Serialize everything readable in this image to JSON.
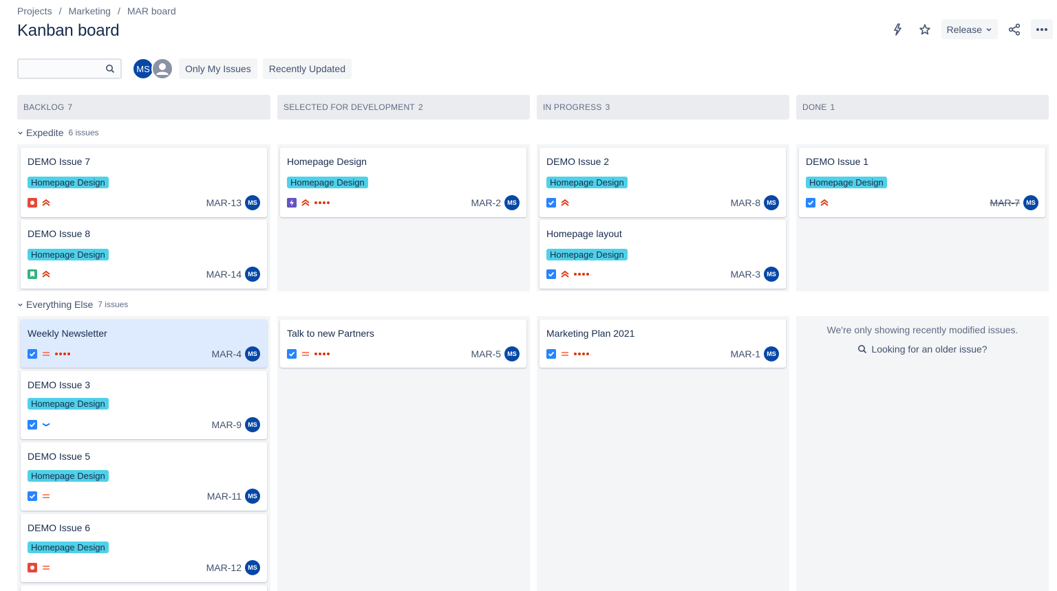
{
  "breadcrumb": [
    "Projects",
    "Marketing",
    "MAR board"
  ],
  "page_title": "Kanban board",
  "actions": {
    "release_label": "Release"
  },
  "toolbar": {
    "search_placeholder": "",
    "avatar_initials": "MS",
    "filters": [
      "Only My Issues",
      "Recently Updated"
    ]
  },
  "columns": [
    {
      "name": "BACKLOG",
      "count": "7"
    },
    {
      "name": "SELECTED FOR DEVELOPMENT",
      "count": "2"
    },
    {
      "name": "IN PROGRESS",
      "count": "3"
    },
    {
      "name": "DONE",
      "count": "1"
    }
  ],
  "swimlanes": [
    {
      "name": "Expedite",
      "count": "6 issues"
    },
    {
      "name": "Everything Else",
      "count": "7 issues"
    }
  ],
  "epic_label": "Homepage Design",
  "assignee_initials": "MS",
  "cards": {
    "c1": {
      "title": "DEMO Issue 7",
      "key": "MAR-13"
    },
    "c2": {
      "title": "DEMO Issue 8",
      "key": "MAR-14"
    },
    "c3": {
      "title": "Homepage Design",
      "key": "MAR-2"
    },
    "c4": {
      "title": "DEMO Issue 2",
      "key": "MAR-8"
    },
    "c5": {
      "title": "Homepage layout",
      "key": "MAR-3"
    },
    "c6": {
      "title": "DEMO Issue 1",
      "key": "MAR-7"
    },
    "c7": {
      "title": "Weekly Newsletter",
      "key": "MAR-4"
    },
    "c8": {
      "title": "DEMO Issue 3",
      "key": "MAR-9"
    },
    "c9": {
      "title": "DEMO Issue 5",
      "key": "MAR-11"
    },
    "c10": {
      "title": "DEMO Issue 6",
      "key": "MAR-12"
    },
    "c11": {
      "title": "Talk to new Partners",
      "key": "MAR-5"
    },
    "c12": {
      "title": "Marketing Plan 2021",
      "key": "MAR-1"
    }
  },
  "done_message": "We're only showing recently modified issues.",
  "done_link": "Looking for an older issue?",
  "colors": {
    "epic": "#4fd1e8",
    "avatar": "#0747a6",
    "priority": "#de350b",
    "task": "#2684ff",
    "bug": "#e5493a",
    "story": "#36b37e",
    "epic_type": "#6554c0"
  }
}
